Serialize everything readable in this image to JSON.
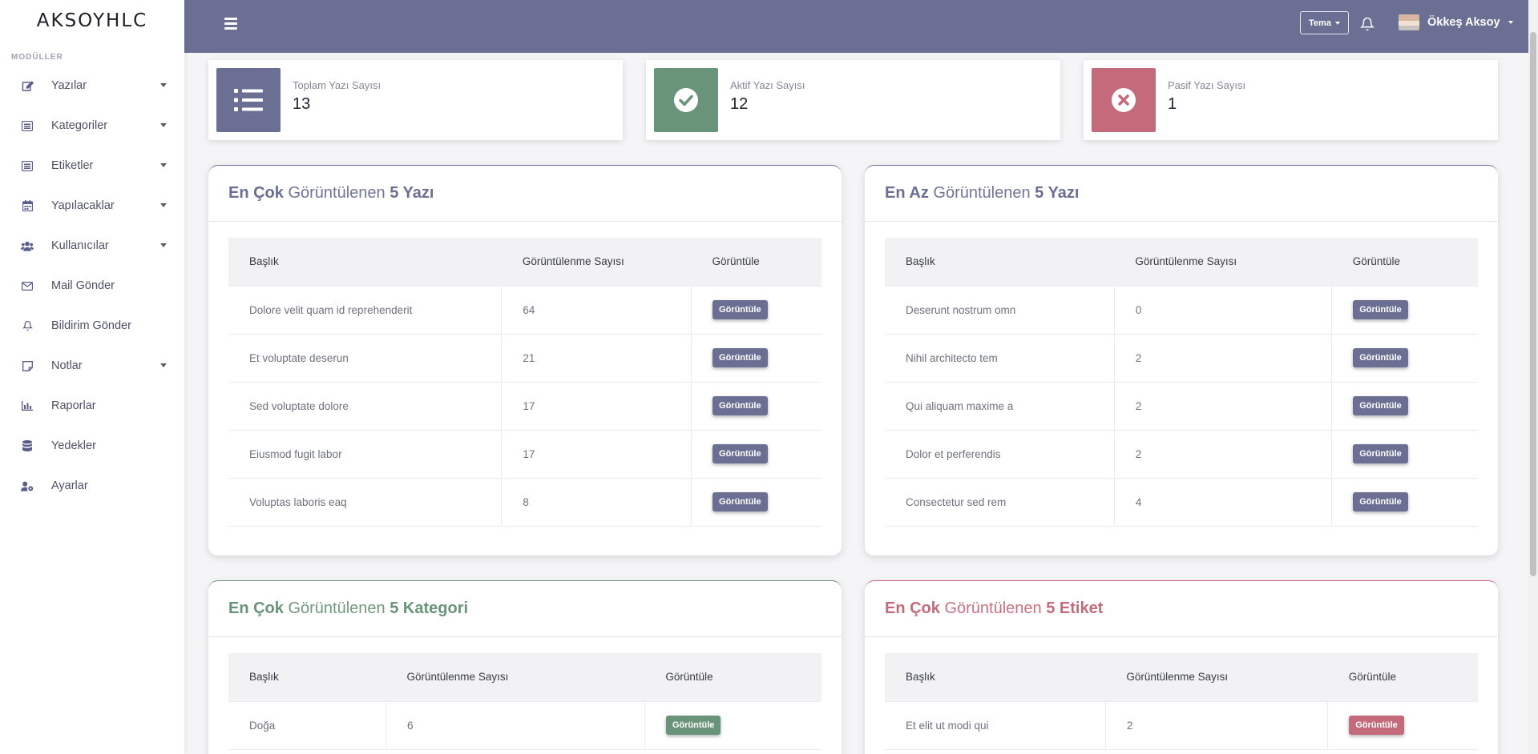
{
  "brand": "AKSOYHLC",
  "sidebar": {
    "heading": "MODÜLLER",
    "items": [
      {
        "label": "Yazılar",
        "icon": "edit-icon",
        "has_caret": true
      },
      {
        "label": "Kategoriler",
        "icon": "list-box-icon",
        "has_caret": true
      },
      {
        "label": "Etiketler",
        "icon": "list-box-icon",
        "has_caret": true
      },
      {
        "label": "Yapılacaklar",
        "icon": "calendar-icon",
        "has_caret": true
      },
      {
        "label": "Kullanıcılar",
        "icon": "users-icon",
        "has_caret": true
      },
      {
        "label": "Mail Gönder",
        "icon": "envelope-icon",
        "has_caret": false
      },
      {
        "label": "Bildirim Gönder",
        "icon": "bell-icon",
        "has_caret": false
      },
      {
        "label": "Notlar",
        "icon": "sticky-note-icon",
        "has_caret": true
      },
      {
        "label": "Raporlar",
        "icon": "bar-chart-icon",
        "has_caret": false
      },
      {
        "label": "Yedekler",
        "icon": "database-icon",
        "has_caret": false
      },
      {
        "label": "Ayarlar",
        "icon": "user-cog-icon",
        "has_caret": false
      }
    ]
  },
  "topbar": {
    "theme_label": "Tema",
    "user_name": "Ökkeş Aksoy"
  },
  "stats": [
    {
      "label": "Toplam Yazı Sayısı",
      "value": "13",
      "icon": "list-icon",
      "color": "#6a6f93"
    },
    {
      "label": "Aktif Yazı Sayısı",
      "value": "12",
      "icon": "check-circle-icon",
      "color": "#6a9479"
    },
    {
      "label": "Pasif Yazı Sayısı",
      "value": "1",
      "icon": "x-circle-icon",
      "color": "#c46a7b"
    }
  ],
  "tables": {
    "most_viewed_posts": {
      "title_bold_1": "En Çok",
      "title_mid": " Görüntülenen ",
      "title_bold_2": "5 Yazı",
      "color": "#6a6f93",
      "columns": [
        "Başlık",
        "Görüntülenme Sayısı",
        "Görüntüle"
      ],
      "button_label": "Görüntüle",
      "rows": [
        {
          "title": "Dolore velit quam id reprehenderit",
          "views": "64"
        },
        {
          "title": "Et voluptate deserun",
          "views": "21"
        },
        {
          "title": "Sed voluptate dolore",
          "views": "17"
        },
        {
          "title": "Eiusmod fugit labor",
          "views": "17"
        },
        {
          "title": "Voluptas laboris eaq",
          "views": "8"
        }
      ]
    },
    "least_viewed_posts": {
      "title_bold_1": "En Az",
      "title_mid": " Görüntülenen ",
      "title_bold_2": "5 Yazı",
      "color": "#6a6f93",
      "columns": [
        "Başlık",
        "Görüntülenme Sayısı",
        "Görüntüle"
      ],
      "button_label": "Görüntüle",
      "rows": [
        {
          "title": "Deserunt nostrum omn",
          "views": "0"
        },
        {
          "title": "Nihil architecto tem",
          "views": "2"
        },
        {
          "title": "Qui aliquam maxime a",
          "views": "2"
        },
        {
          "title": "Dolor et perferendis",
          "views": "2"
        },
        {
          "title": "Consectetur sed rem",
          "views": "4"
        }
      ]
    },
    "most_viewed_categories": {
      "title_bold_1": "En Çok",
      "title_mid": " Görüntülenen ",
      "title_bold_2": "5 Kategori",
      "color": "#6a9479",
      "columns": [
        "Başlık",
        "Görüntülenme Sayısı",
        "Görüntüle"
      ],
      "button_label": "Görüntüle",
      "rows": [
        {
          "title": "Doğa",
          "views": "6"
        }
      ]
    },
    "most_viewed_tags": {
      "title_bold_1": "En Çok",
      "title_mid": " Görüntülenen ",
      "title_bold_2": "5 Etiket",
      "color": "#c46a7b",
      "columns": [
        "Başlık",
        "Görüntülenme Sayısı",
        "Görüntüle"
      ],
      "button_label": "Görüntüle",
      "rows": [
        {
          "title": "Et elit ut modi qui",
          "views": "2"
        }
      ]
    }
  }
}
